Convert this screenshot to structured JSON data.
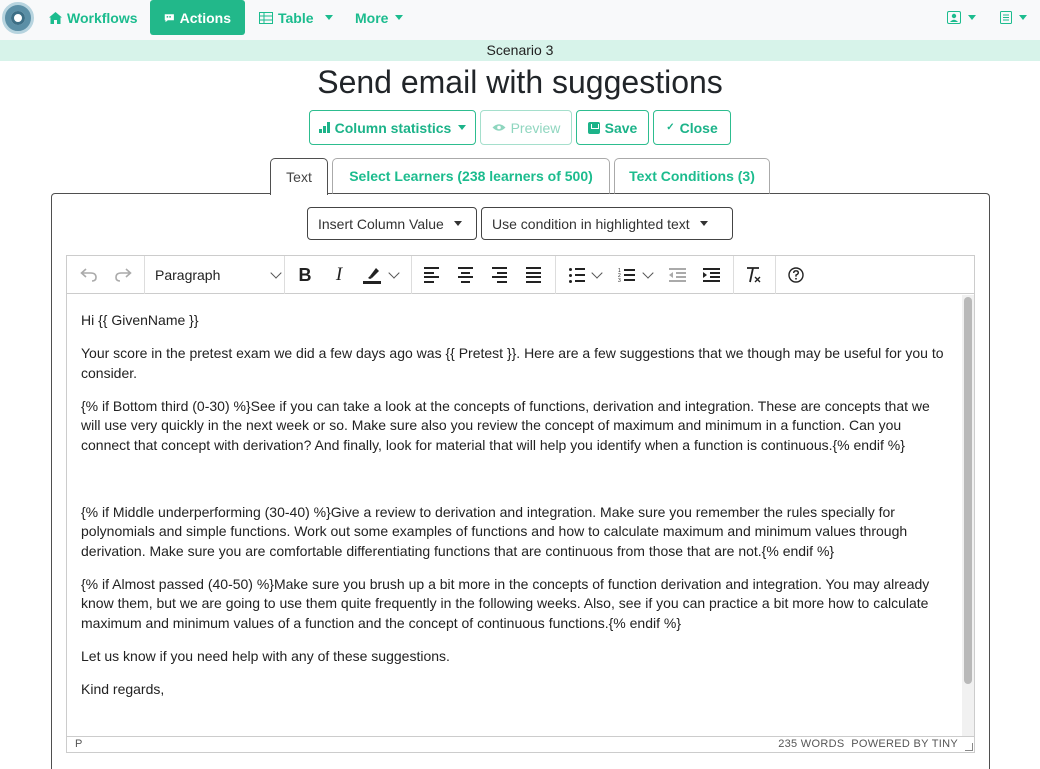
{
  "nav": {
    "workflows": "Workflows",
    "actions": "Actions",
    "table": "Table",
    "more": "More"
  },
  "scenario": "Scenario 3",
  "page_title": "Send email with suggestions",
  "buttons": {
    "column_statistics": "Column statistics",
    "preview": "Preview",
    "save": "Save",
    "close": "Close"
  },
  "tabs": {
    "text": "Text",
    "select_learners": "Select Learners (238 learners of 500)",
    "text_conditions": "Text Conditions (3)"
  },
  "insert_column_value": "Insert Column Value",
  "use_condition": "Use condition in highlighted text",
  "toolbar": {
    "block_format": "Paragraph"
  },
  "content": {
    "p1": "Hi {{ GivenName }}",
    "p2": "Your score in the pretest exam we did a few days ago was {{ Pretest }}. Here are a few suggestions that we though may be useful for you to consider.",
    "p3": "{% if Bottom third (0-30) %}See if you can take a look at the concepts of functions, derivation and integration. These are concepts that we will use very quickly in the next week or so. Make sure also you review the concept of maximum and minimum in a function. Can you connect that concept with derivation? And finally, look for material that will help you identify when a function is continuous.{% endif %}",
    "p4": "{% if Middle underperforming (30-40) %}Give a review to derivation and integration. Make sure you remember the rules specially for polynomials and simple functions. Work out some examples of functions and how to calculate maximum and minimum values through derivation. Make sure you are comfortable differentiating functions that are continuous from those that are not.{% endif %}",
    "p5": "{% if Almost passed (40-50) %}Make sure you brush up a bit more in the concepts of function derivation and integration. You may already know them, but we are going to use them quite frequently in the following weeks. Also, see if you can practice a bit more how to calculate maximum and minimum values of a function and the concept of continuous functions.{% endif %}",
    "p6": "Let us know if you need help with any of these suggestions.",
    "p7": "Kind regards,"
  },
  "statusbar": {
    "path": "P",
    "words": "235 WORDS",
    "powered": "POWERED BY TINY"
  },
  "colors": {
    "accent": "#22b88a",
    "scenario_bg": "#d7f3ea"
  }
}
